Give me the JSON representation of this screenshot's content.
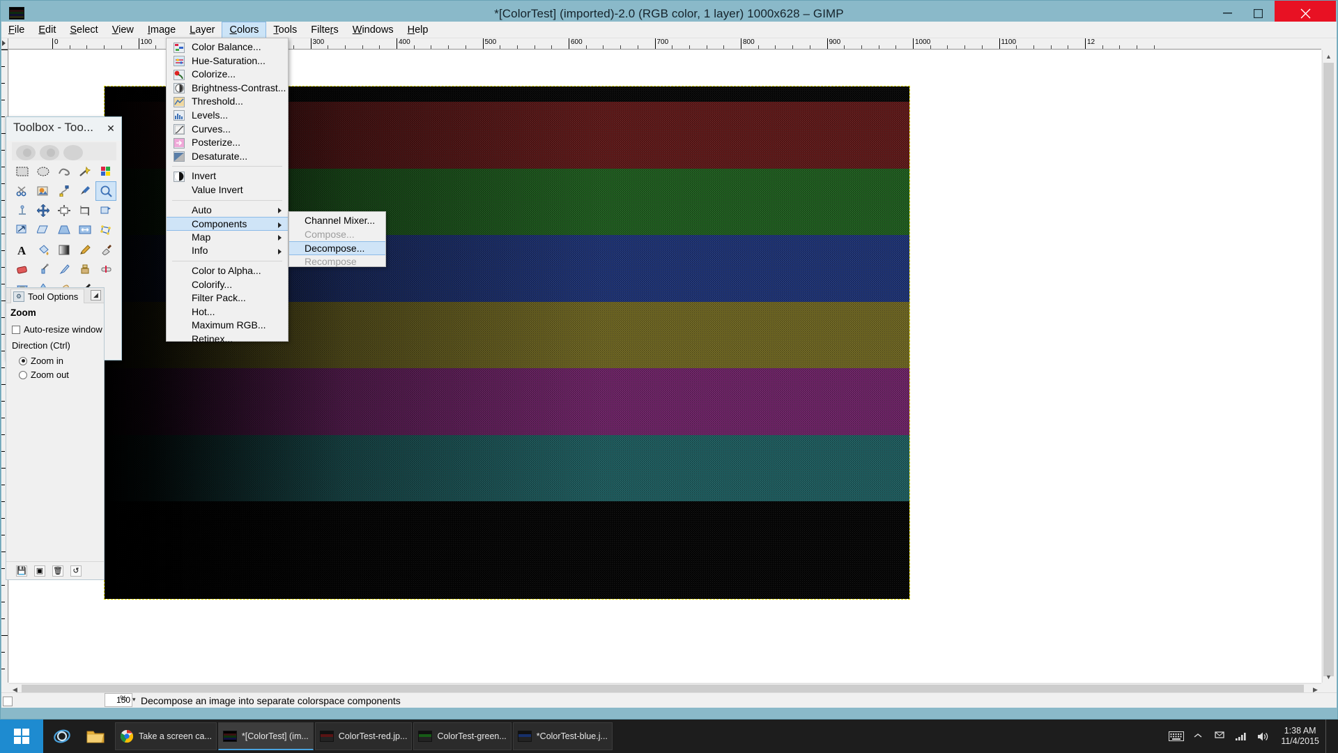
{
  "window": {
    "title": "*[ColorTest] (imported)-2.0 (RGB color, 1 layer) 1000x628 – GIMP",
    "minimize_label": "—",
    "maximize_label": "▢",
    "close_label": "✕"
  },
  "menubar": {
    "items": [
      {
        "label": "File",
        "mnemonic": "F",
        "open": false
      },
      {
        "label": "Edit",
        "mnemonic": "E",
        "open": false
      },
      {
        "label": "Select",
        "mnemonic": "S",
        "open": false
      },
      {
        "label": "View",
        "mnemonic": "V",
        "open": false
      },
      {
        "label": "Image",
        "mnemonic": "I",
        "open": false
      },
      {
        "label": "Layer",
        "mnemonic": "L",
        "open": false
      },
      {
        "label": "Colors",
        "mnemonic": "C",
        "open": true
      },
      {
        "label": "Tools",
        "mnemonic": "T",
        "open": false
      },
      {
        "label": "Filters",
        "mnemonic": "r",
        "open": false
      },
      {
        "label": "Windows",
        "mnemonic": "W",
        "open": false
      },
      {
        "label": "Help",
        "mnemonic": "H",
        "open": false
      }
    ]
  },
  "colors_menu": {
    "items": [
      {
        "label": "Color Balance...",
        "icon": "color-balance-icon",
        "type": "item",
        "disabled": false,
        "highlighted": false,
        "submenu": false
      },
      {
        "label": "Hue-Saturation...",
        "icon": "hue-saturation-icon",
        "type": "item",
        "disabled": false,
        "highlighted": false,
        "submenu": false
      },
      {
        "label": "Colorize...",
        "icon": "colorize-icon",
        "type": "item",
        "disabled": false,
        "highlighted": false,
        "submenu": false
      },
      {
        "label": "Brightness-Contrast...",
        "icon": "brightness-contrast-icon",
        "type": "item",
        "disabled": false,
        "highlighted": false,
        "submenu": false
      },
      {
        "label": "Threshold...",
        "icon": "threshold-icon",
        "type": "item",
        "disabled": false,
        "highlighted": false,
        "submenu": false
      },
      {
        "label": "Levels...",
        "icon": "levels-icon",
        "type": "item",
        "disabled": false,
        "highlighted": false,
        "submenu": false
      },
      {
        "label": "Curves...",
        "icon": "curves-icon",
        "type": "item",
        "disabled": false,
        "highlighted": false,
        "submenu": false
      },
      {
        "label": "Posterize...",
        "icon": "posterize-icon",
        "type": "item",
        "disabled": false,
        "highlighted": false,
        "submenu": false
      },
      {
        "label": "Desaturate...",
        "icon": "desaturate-icon",
        "type": "item",
        "disabled": false,
        "highlighted": false,
        "submenu": false
      },
      {
        "type": "separator"
      },
      {
        "label": "Invert",
        "icon": "invert-icon",
        "type": "item",
        "disabled": false,
        "highlighted": false,
        "submenu": false
      },
      {
        "label": "Value Invert",
        "icon": "",
        "type": "item",
        "disabled": false,
        "highlighted": false,
        "submenu": false
      },
      {
        "type": "separator"
      },
      {
        "label": "Auto",
        "icon": "",
        "type": "item",
        "disabled": false,
        "highlighted": false,
        "submenu": true
      },
      {
        "label": "Components",
        "icon": "",
        "type": "item",
        "disabled": false,
        "highlighted": true,
        "submenu": true
      },
      {
        "label": "Map",
        "icon": "",
        "type": "item",
        "disabled": false,
        "highlighted": false,
        "submenu": true
      },
      {
        "label": "Info",
        "icon": "",
        "type": "item",
        "disabled": false,
        "highlighted": false,
        "submenu": true
      },
      {
        "type": "separator"
      },
      {
        "label": "Color to Alpha...",
        "icon": "",
        "type": "item",
        "disabled": false,
        "highlighted": false,
        "submenu": false
      },
      {
        "label": "Colorify...",
        "icon": "",
        "type": "item",
        "disabled": false,
        "highlighted": false,
        "submenu": false
      },
      {
        "label": "Filter Pack...",
        "icon": "",
        "type": "item",
        "disabled": false,
        "highlighted": false,
        "submenu": false
      },
      {
        "label": "Hot...",
        "icon": "",
        "type": "item",
        "disabled": false,
        "highlighted": false,
        "submenu": false
      },
      {
        "label": "Maximum RGB...",
        "icon": "",
        "type": "item",
        "disabled": false,
        "highlighted": false,
        "submenu": false
      },
      {
        "label": "Retinex...",
        "icon": "",
        "type": "item",
        "disabled": false,
        "highlighted": false,
        "submenu": false
      }
    ]
  },
  "components_submenu": {
    "items": [
      {
        "label": "Channel Mixer...",
        "disabled": false,
        "highlighted": false
      },
      {
        "label": "Compose...",
        "disabled": true,
        "highlighted": false
      },
      {
        "label": "Decompose...",
        "disabled": false,
        "highlighted": true
      },
      {
        "label": "Recompose",
        "disabled": true,
        "highlighted": false
      }
    ]
  },
  "toolbox": {
    "title": "Toolbox - Too...",
    "close_label": "✕",
    "tools": [
      "rect-select-tool",
      "ellipse-select-tool",
      "free-select-tool",
      "fuzzy-select-tool",
      "select-by-color-tool",
      "scissors-select-tool",
      "foreground-select-tool",
      "paths-tool",
      "color-picker-tool",
      "zoom-tool",
      "measure-tool",
      "move-tool",
      "alignment-tool",
      "crop-tool",
      "rotate-tool",
      "scale-tool",
      "shear-tool",
      "perspective-tool",
      "flip-tool",
      "cage-transform-tool",
      "text-tool",
      "bucket-fill-tool",
      "gradient-tool",
      "pencil-tool",
      "paintbrush-tool",
      "eraser-tool",
      "airbrush-tool",
      "ink-tool",
      "clone-tool",
      "heal-tool",
      "perspective-clone-tool",
      "blur-sharpen-tool",
      "smudge-tool",
      "dodge-burn-tool"
    ],
    "selected_tool": "zoom-tool",
    "selected_index": 9,
    "foreground_color": "#000000",
    "background_color": "#ffffff"
  },
  "tool_options": {
    "tab_label": "Tool Options",
    "heading": "Zoom",
    "auto_resize_label": "Auto-resize window",
    "auto_resize_checked": false,
    "direction_label": "Direction  (Ctrl)",
    "direction_options": [
      "Zoom in",
      "Zoom out"
    ],
    "direction_selected": "Zoom in"
  },
  "canvas": {
    "zoom_value": "150",
    "zoom_unit": "%",
    "status_text": "Decompose an image into separate colorspace components",
    "ruler_ticks": [
      "0",
      "100",
      "200",
      "300",
      "400",
      "500",
      "600",
      "700",
      "800",
      "900",
      "1000",
      "1100",
      "12"
    ],
    "image_bands": [
      {
        "name": "black-top",
        "color": "#050505",
        "height_pct": 3
      },
      {
        "name": "red-band",
        "color": "#5c1717",
        "height_pct": 13
      },
      {
        "name": "green-band",
        "color": "#1d5a1d",
        "height_pct": 13
      },
      {
        "name": "blue-band",
        "color": "#1c3172",
        "height_pct": 13
      },
      {
        "name": "yellow-band",
        "color": "#6b6320",
        "height_pct": 13
      },
      {
        "name": "magenta-band",
        "color": "#6a2163",
        "height_pct": 13
      },
      {
        "name": "cyan-band",
        "color": "#1c5a5c",
        "height_pct": 13
      },
      {
        "name": "black-bottom",
        "color": "#030303",
        "height_pct": 19
      }
    ]
  },
  "taskbar": {
    "start_label": "Start",
    "pinned": [
      "internet-explorer-icon",
      "file-explorer-icon"
    ],
    "tasks": [
      {
        "label": "Take a screen ca...",
        "icon": "chrome-icon",
        "active": false
      },
      {
        "label": "*[ColorTest] (im...",
        "icon": "gimp-icon",
        "active": true
      },
      {
        "label": "ColorTest-red.jp...",
        "icon": "image-red-icon",
        "active": false
      },
      {
        "label": "ColorTest-green...",
        "icon": "image-green-icon",
        "active": false
      },
      {
        "label": "*ColorTest-blue.j...",
        "icon": "image-blue-icon",
        "active": false
      }
    ],
    "tray_icons": [
      "keyboard-icon",
      "show-hidden-icon",
      "flag-icon",
      "network-icon",
      "volume-icon"
    ],
    "clock_time": "1:38 AM",
    "clock_date": "11/4/2015"
  }
}
